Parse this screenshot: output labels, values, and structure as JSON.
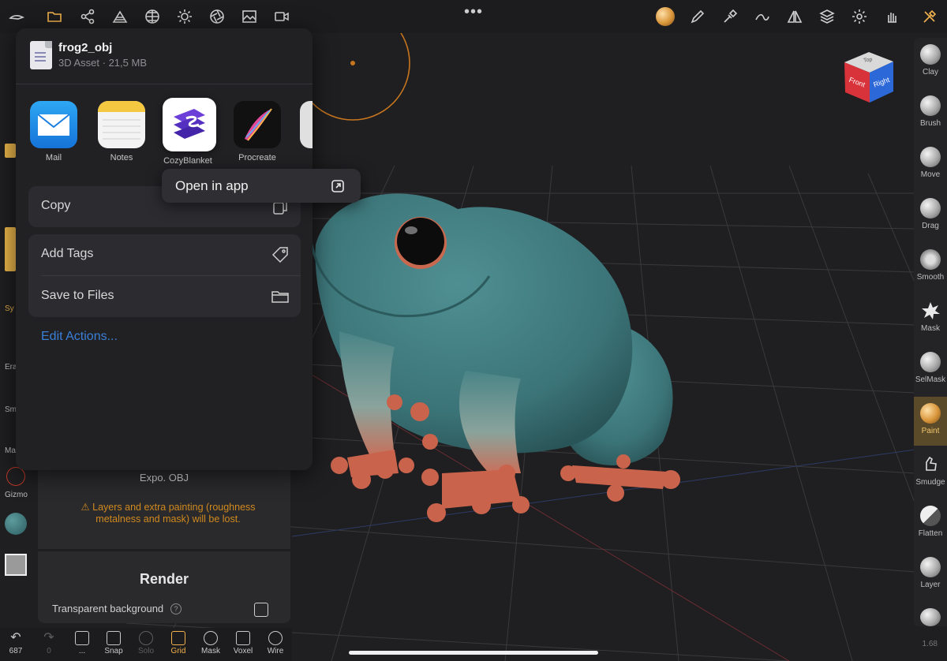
{
  "share_sheet": {
    "file_name": "frog2_obj",
    "file_meta": "3D Asset · 21,5 MB",
    "apps": [
      {
        "label": "Mail"
      },
      {
        "label": "Notes"
      },
      {
        "label": "CozyBlanket"
      },
      {
        "label": "Procreate"
      }
    ],
    "actions": {
      "copy": "Copy",
      "add_tags": "Add Tags",
      "save_to_files": "Save to Files",
      "edit_actions": "Edit Actions..."
    }
  },
  "context_menu": {
    "open_in_app": "Open in app"
  },
  "export_panel": {
    "export_label": "Expo. OBJ",
    "warning": "⚠ Layers and extra painting (roughness metalness and mask) will be lost.",
    "render_title": "Render",
    "transparent_bg": "Transparent background",
    "help": "?"
  },
  "nav_cube": {
    "front": "Front",
    "right": "Right",
    "top": "Top"
  },
  "brushes": [
    {
      "label": "Clay"
    },
    {
      "label": "Brush"
    },
    {
      "label": "Move"
    },
    {
      "label": "Drag"
    },
    {
      "label": "Smooth"
    },
    {
      "label": "Mask"
    },
    {
      "label": "SelMask"
    },
    {
      "label": "Paint",
      "active": true
    },
    {
      "label": "Smudge"
    },
    {
      "label": "Flatten"
    },
    {
      "label": "Layer"
    }
  ],
  "left_strip": {
    "era": "Era",
    "smo": "Smo",
    "ma": "Ma",
    "sy": "Sy",
    "gizmo": "Gizmo"
  },
  "bottom_bar": {
    "undo_count": "687",
    "redo_count": "0",
    "more": "...",
    "snap": "Snap",
    "solo": "Solo",
    "grid": "Grid",
    "mask": "Mask",
    "voxel": "Voxel",
    "wire": "Wire"
  },
  "version": "1.68",
  "colors": {
    "accent": "#f2b24d",
    "link": "#3a7fd8",
    "warning": "#d08a1e",
    "frog_body": "#3f7d80",
    "frog_toes": "#d0604a"
  }
}
